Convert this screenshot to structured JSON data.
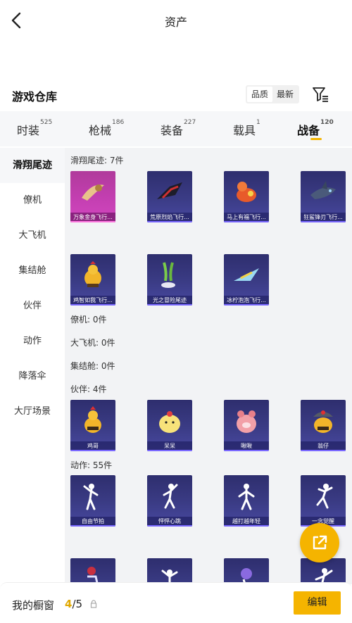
{
  "header": {
    "title": "资产"
  },
  "section": {
    "title": "游戏仓库",
    "sort_quality": "品质",
    "sort_latest": "最新"
  },
  "tabs": [
    {
      "label": "时装",
      "count": "525"
    },
    {
      "label": "枪械",
      "count": "186"
    },
    {
      "label": "装备",
      "count": "227"
    },
    {
      "label": "载具",
      "count": "1"
    },
    {
      "label": "战备",
      "count": "120"
    }
  ],
  "sidebar": {
    "items": [
      "滑翔尾迹",
      "僚机",
      "大飞机",
      "集结舱",
      "伙伴",
      "动作",
      "降落伞",
      "大厅场景"
    ]
  },
  "groups": {
    "trail": {
      "label": "滑翔尾迹: 7件",
      "items": [
        "万象金身飞行...",
        "荒原烈焰飞行...",
        "马上有福飞行...",
        "狂鲨锋刃飞行...",
        "鸡智如我飞行...",
        "光之冒险尾迹",
        "冰柠泡泡飞行..."
      ]
    },
    "wingman": {
      "label": "僚机: 0件"
    },
    "plane": {
      "label": "大飞机: 0件"
    },
    "capsule": {
      "label": "集结舱: 0件"
    },
    "partner": {
      "label": "伙伴: 4件",
      "items": [
        "鸡哥",
        "呆呆",
        "啾啾",
        "翁仔"
      ]
    },
    "emote": {
      "label": "动作: 55件",
      "items": [
        "自由节拍",
        "怦怦心跳",
        "越打越年轻",
        "一念觉醒"
      ]
    }
  },
  "bottom": {
    "title": "我的橱窗",
    "current": "4",
    "separator": "/",
    "total": "5",
    "edit_label": "编辑"
  },
  "colors": {
    "accent": "#f5b400",
    "card": "#3b3c86",
    "card_rare": "#c43fb2"
  }
}
